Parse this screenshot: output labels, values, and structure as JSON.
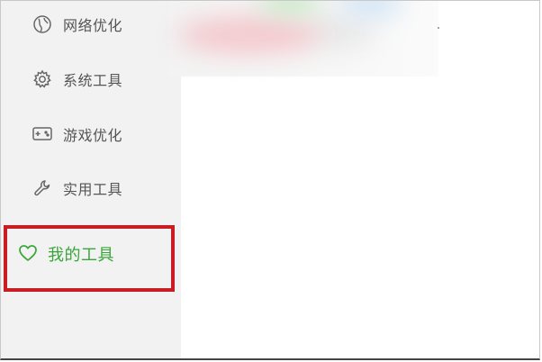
{
  "sidebar": {
    "items": [
      {
        "label": "网络优化",
        "icon": "globe-icon"
      },
      {
        "label": "系统工具",
        "icon": "gear-icon"
      },
      {
        "label": "游戏优化",
        "icon": "gamepad-icon"
      },
      {
        "label": "实用工具",
        "icon": "wrench-icon"
      },
      {
        "label": "我的工具",
        "icon": "heart-icon",
        "active": true
      }
    ]
  },
  "colors": {
    "sidebar_bg": "#f2f2f2",
    "text_default": "#555555",
    "active_green": "#3aa63a",
    "highlight_red": "#c81e23"
  }
}
